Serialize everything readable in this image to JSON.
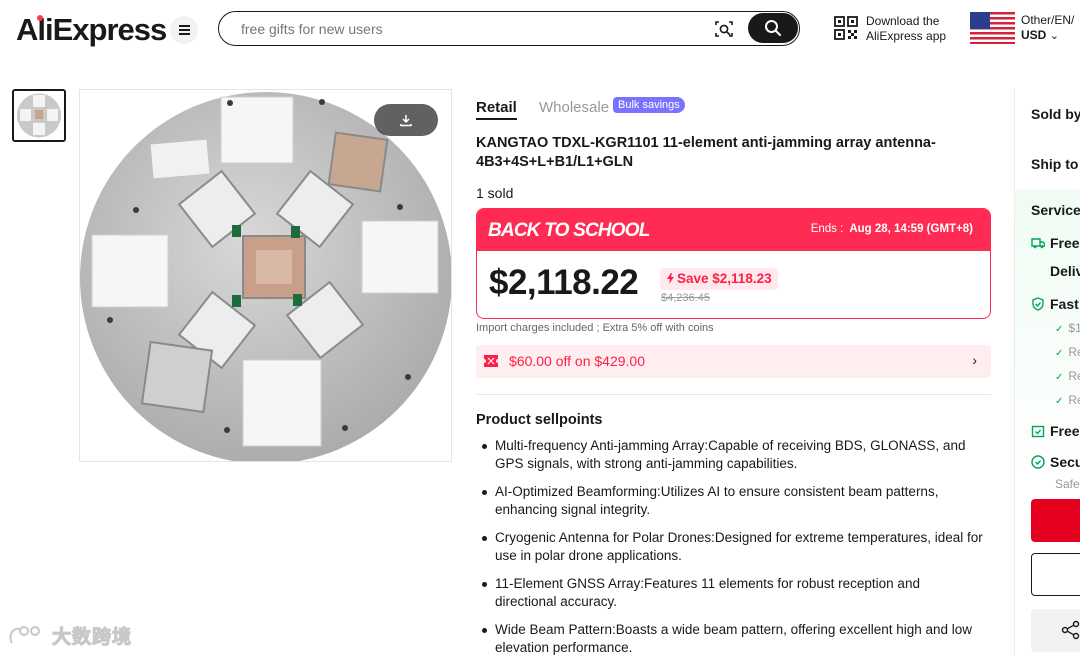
{
  "header": {
    "logo_text": "AliExpress",
    "search_placeholder": "free gifts for new users",
    "app_download_line1": "Download the",
    "app_download_line2": "AliExpress app",
    "locale_line1": "Other/EN/",
    "currency": "USD"
  },
  "product": {
    "tab_retail": "Retail",
    "tab_wholesale": "Wholesale",
    "bulk_badge": "Bulk savings",
    "title": "KANGTAO TDXL-KGR1101 11-element anti-jamming array antenna-4B3+4S+L+B1/L1+GLN",
    "sold": "1 sold",
    "promo_name": "BACK TO SCHOOL",
    "promo_ends_label": "Ends :",
    "promo_ends_value": "Aug 28, 14:59 (GMT+8)",
    "price": "$2,118.22",
    "save_label": "Save $2,118.23",
    "original_price": "$4,236.45",
    "import_note": "Import charges included ; Extra 5% off with coins",
    "coupon_text": "$60.00 off on $429.00",
    "coupon_arrow": "›"
  },
  "sellpoints": {
    "title": "Product sellpoints",
    "items": [
      "Multi-frequency Anti-jamming Array:Capable of receiving BDS, GLONASS, and GPS signals, with strong anti-jamming capabilities.",
      "AI-Optimized Beamforming:Utilizes AI to ensure consistent beam patterns, enhancing signal integrity.",
      "Cryogenic Antenna for Polar Drones:Designed for extreme temperatures, ideal for use in polar drone applications.",
      "11-Element GNSS Array:Features 11 elements for robust reception and directional accuracy.",
      "Wide Beam Pattern:Boasts a wide beam pattern, offering excellent high and low elevation performance."
    ]
  },
  "right_panel": {
    "sold_by": "Sold by",
    "ship_to": "Ship to",
    "service": "Service",
    "free_shipping": "Free",
    "delivery": "Deliv",
    "fast": "Fast",
    "fast_sub": [
      "$1",
      "Re",
      "Re",
      "Re"
    ],
    "free_returns": "Free",
    "secure": "Secu",
    "safe": "Safe"
  },
  "watermark": "大数跨境",
  "colors": {
    "accent": "#ff2b54",
    "price_red": "#ff1e46",
    "bulk_badge": "#7a73ff",
    "service_green": "#00a656"
  }
}
